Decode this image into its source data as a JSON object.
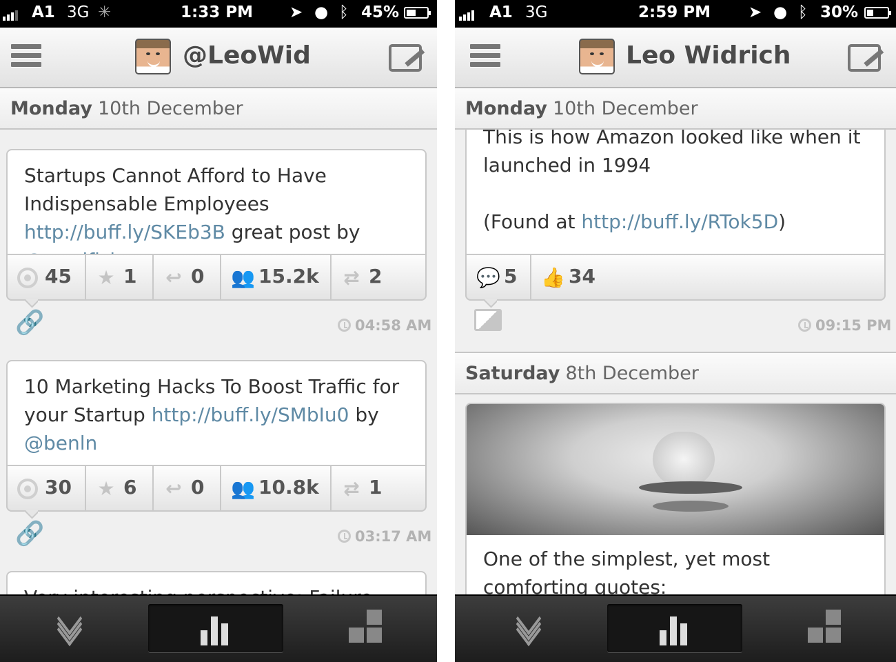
{
  "left": {
    "status": {
      "carrier": "A1",
      "network": "3G",
      "time": "1:33 PM",
      "battery": "45%",
      "battery_fraction": 0.45
    },
    "header": {
      "title": "@LeoWid"
    },
    "day": {
      "weekday": "Monday",
      "date": "10th December"
    },
    "posts": [
      {
        "text": "Startups Cannot Afford to Have Indispensable Employees ",
        "link": "http://buff.ly/SKEb3B",
        "text2": " great post by ",
        "mention": "@randfish",
        "stats": {
          "clicks": "45",
          "favorites": "1",
          "replies": "0",
          "reach": "15.2k",
          "retweets": "2"
        },
        "time": "04:58 AM"
      },
      {
        "text": "10 Marketing Hacks To Boost Traffic for your Startup ",
        "link": "http://buff.ly/SMbIu0",
        "text2": " by ",
        "mention": "@benln",
        "stats": {
          "clicks": "30",
          "favorites": "6",
          "replies": "0",
          "reach": "10.8k",
          "retweets": "1"
        },
        "time": "03:17 AM"
      },
      {
        "text": "Very interesting perspective: Failure Has"
      }
    ]
  },
  "right": {
    "status": {
      "carrier": "A1",
      "network": "3G",
      "time": "2:59 PM",
      "battery": "30%",
      "battery_fraction": 0.3
    },
    "header": {
      "title": "Leo Widrich"
    },
    "day1": {
      "weekday": "Monday",
      "date": "10th December"
    },
    "post1": {
      "line1": "This is how Amazon looked like when it",
      "line2": "launched in 1994",
      "found_prefix": "(Found at ",
      "link": "http://buff.ly/RTok5D",
      "found_suffix": ")",
      "comments": "5",
      "likes": "34",
      "time": "09:15 PM"
    },
    "day2": {
      "weekday": "Saturday",
      "date": "8th December"
    },
    "post2": {
      "text": "One of the simplest, yet most comforting quotes:"
    }
  }
}
